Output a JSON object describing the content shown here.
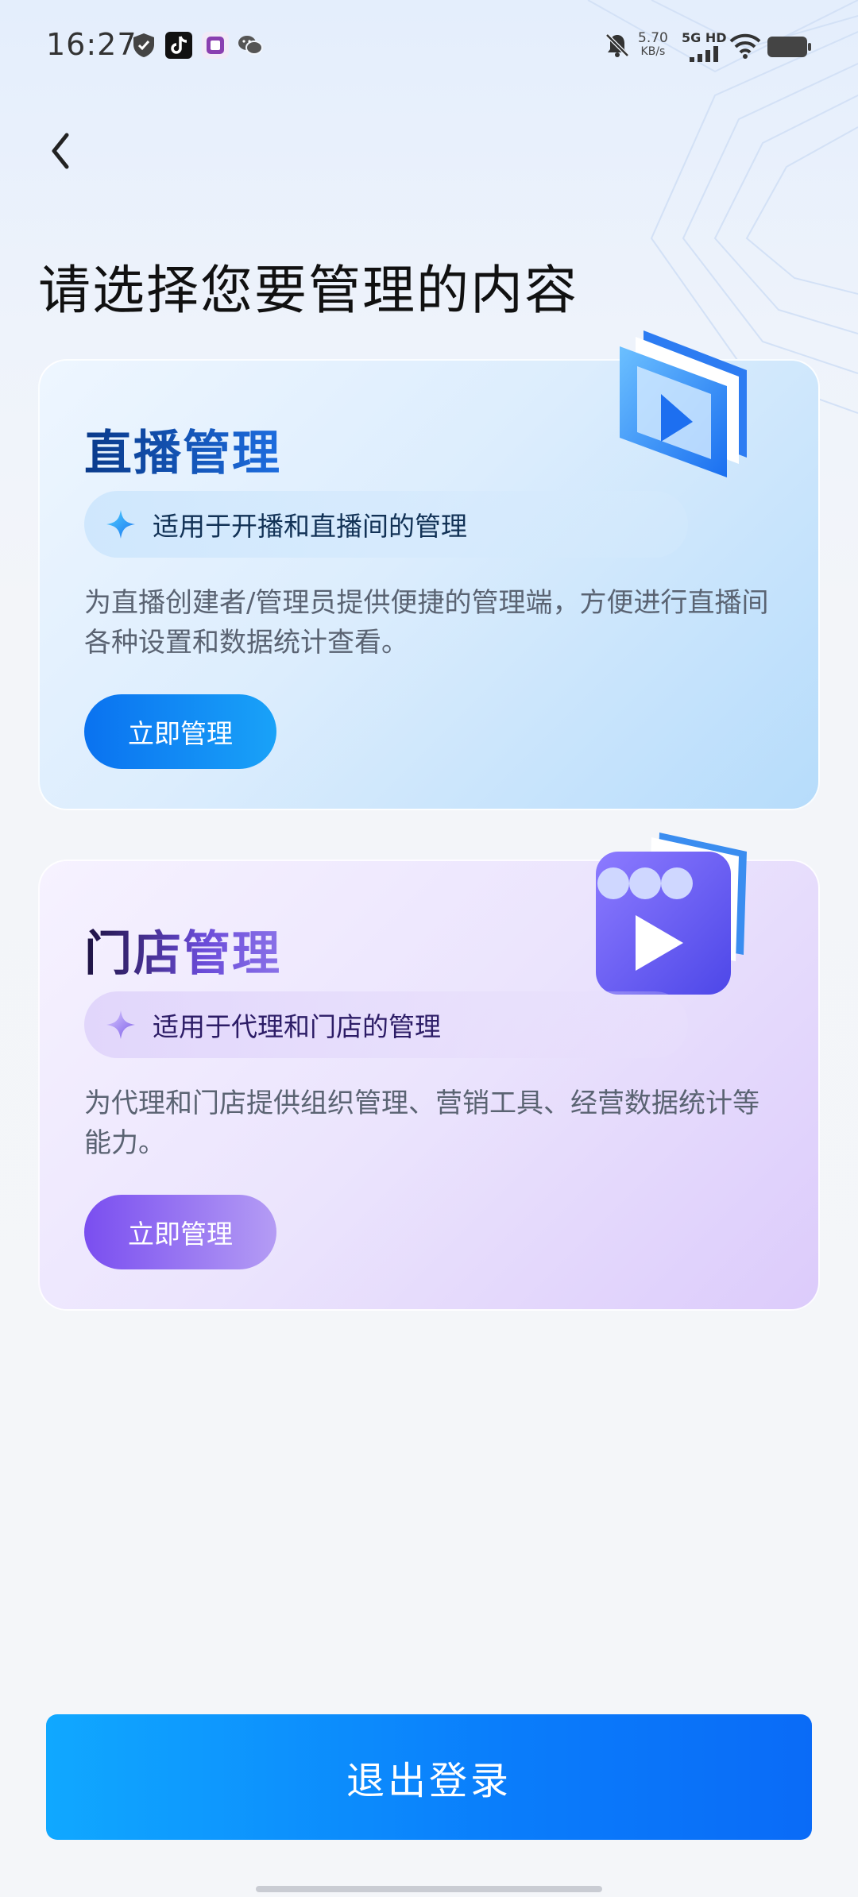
{
  "status_bar": {
    "time": "16:27",
    "net_speed_value": "5.70",
    "net_speed_unit": "KB/s",
    "network_type": "5G HD",
    "icons": [
      "shield-icon",
      "tiktok-icon",
      "sticker-app-icon",
      "wechat-icon",
      "mute-bell-icon",
      "signal-icon",
      "wifi-icon",
      "battery-icon"
    ]
  },
  "header": {
    "back_icon": "chevron-left-icon",
    "title": "请选择您要管理的内容"
  },
  "cards": [
    {
      "title": "直播管理",
      "tag": "适用于开播和直播间的管理",
      "description": "为直播创建者/管理员提供便捷的管理端，方便进行直播间各种设置和数据统计查看。",
      "button": "立即管理",
      "icon": "video-play-icon",
      "accent": "#0a72f0"
    },
    {
      "title": "门店管理",
      "tag": "适用于代理和门店的管理",
      "description": "为代理和门店提供组织管理、营销工具、经营数据统计等能力。",
      "button": "立即管理",
      "icon": "store-play-icon",
      "accent": "#7a4ef0"
    }
  ],
  "footer": {
    "logout_label": "退出登录",
    "accent": "#0a7dfb"
  }
}
